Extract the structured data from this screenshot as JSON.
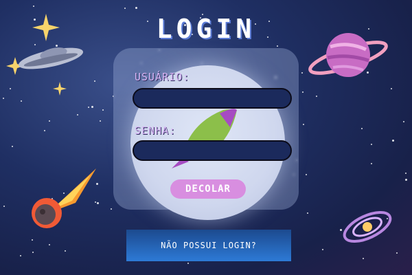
{
  "page": {
    "title": "LOGIN"
  },
  "form": {
    "username_label": "USUÁRIO:",
    "username_value": "",
    "password_label": "SENHA:",
    "password_value": "",
    "submit_label": "DECOLAR"
  },
  "footer": {
    "no_login_label": "NÃO POSSUI LOGIN?"
  },
  "colors": {
    "background": "#1f2f63",
    "label": "#d8b6f5",
    "field_bg": "#1b2a5c",
    "submit_bg": "#d88ee0",
    "secondary_button": "#2d7ad6"
  },
  "icons": [
    "sparkle-icon",
    "ufo-icon",
    "planet-icon",
    "meteor-icon",
    "galaxy-icon",
    "rocket-icon",
    "moon-icon"
  ]
}
